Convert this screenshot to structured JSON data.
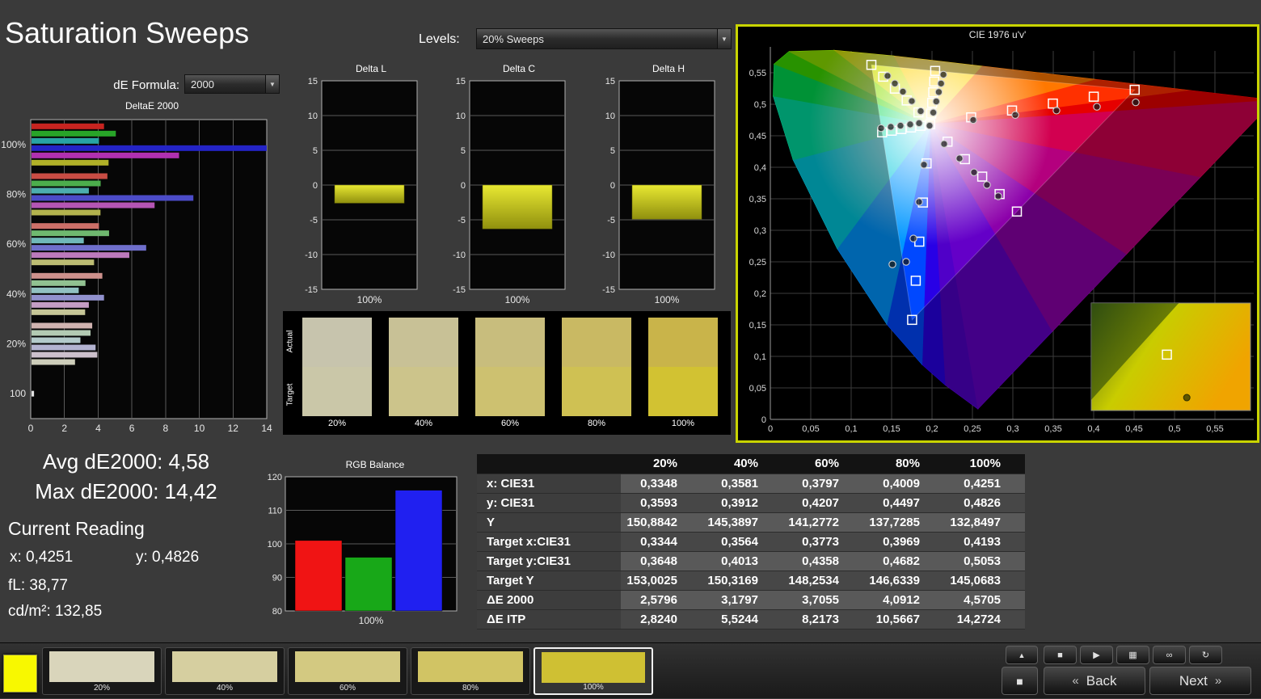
{
  "page": {
    "title": "Saturation Sweeps"
  },
  "controls": {
    "de_formula_label": "dE Formula:",
    "de_formula_value": "2000",
    "levels_label": "Levels:",
    "levels_value": "20% Sweeps"
  },
  "stats": {
    "avg": "Avg dE2000: 4,58",
    "max": "Max dE2000: 14,42",
    "current_reading": "Current Reading",
    "x": "x: 0,4251",
    "y": "y: 0,4826",
    "fl": "fL: 38,77",
    "cdm2": "cd/m²: 132,85"
  },
  "chart_data": [
    {
      "id": "deltae2000",
      "type": "bar",
      "orientation": "horizontal",
      "title": "DeltaE 2000",
      "xlim": [
        0,
        14
      ],
      "xticks": [
        0,
        2,
        4,
        6,
        8,
        10,
        12,
        14
      ],
      "groups": [
        {
          "label": "100%",
          "bars": [
            {
              "name": "red",
              "value": 4.3,
              "color": "#c62420"
            },
            {
              "name": "green",
              "value": 5.0,
              "color": "#28a428"
            },
            {
              "name": "cyan",
              "value": 4.0,
              "color": "#28a4a4"
            },
            {
              "name": "blue",
              "value": 14.42,
              "color": "#2424c6"
            },
            {
              "name": "magenta",
              "value": 8.75,
              "color": "#b030b0"
            },
            {
              "name": "yellow",
              "value": 4.57,
              "color": "#b0b028"
            }
          ]
        },
        {
          "label": "80%",
          "bars": [
            {
              "name": "red",
              "value": 4.5,
              "color": "#c84c44"
            },
            {
              "name": "green",
              "value": 4.1,
              "color": "#4cae4c"
            },
            {
              "name": "cyan",
              "value": 3.4,
              "color": "#4caeae"
            },
            {
              "name": "blue",
              "value": 9.6,
              "color": "#4c4cc8"
            },
            {
              "name": "magenta",
              "value": 7.3,
              "color": "#b455b4"
            },
            {
              "name": "yellow",
              "value": 4.09,
              "color": "#b2b24e"
            }
          ]
        },
        {
          "label": "60%",
          "bars": [
            {
              "name": "red",
              "value": 4.0,
              "color": "#cb6f68"
            },
            {
              "name": "green",
              "value": 4.6,
              "color": "#6fb86f"
            },
            {
              "name": "cyan",
              "value": 3.1,
              "color": "#6fb8b8"
            },
            {
              "name": "blue",
              "value": 6.8,
              "color": "#6f6fcb"
            },
            {
              "name": "magenta",
              "value": 5.8,
              "color": "#bc79bc"
            },
            {
              "name": "yellow",
              "value": 3.71,
              "color": "#bcbc73"
            }
          ]
        },
        {
          "label": "40%",
          "bars": [
            {
              "name": "red",
              "value": 4.2,
              "color": "#cd918c"
            },
            {
              "name": "green",
              "value": 3.2,
              "color": "#91c191"
            },
            {
              "name": "cyan",
              "value": 2.8,
              "color": "#91c1c1"
            },
            {
              "name": "blue",
              "value": 4.3,
              "color": "#9191cd"
            },
            {
              "name": "magenta",
              "value": 3.4,
              "color": "#c49dc4"
            },
            {
              "name": "yellow",
              "value": 3.18,
              "color": "#c5c597"
            }
          ]
        },
        {
          "label": "20%",
          "bars": [
            {
              "name": "red",
              "value": 3.6,
              "color": "#d0b3b0"
            },
            {
              "name": "green",
              "value": 3.5,
              "color": "#b3cab3"
            },
            {
              "name": "cyan",
              "value": 2.9,
              "color": "#b3caca"
            },
            {
              "name": "blue",
              "value": 3.8,
              "color": "#b3b3d0"
            },
            {
              "name": "magenta",
              "value": 3.9,
              "color": "#ccc0cc"
            },
            {
              "name": "yellow",
              "value": 2.58,
              "color": "#cdcdba"
            }
          ]
        },
        {
          "label": "100",
          "bars": [
            {
              "name": "white",
              "value": 0.15,
              "color": "#e2e2e2"
            }
          ]
        }
      ]
    },
    {
      "id": "delta_l",
      "type": "bar",
      "title": "Delta L",
      "ylim": [
        -15,
        15
      ],
      "yticks": [
        15,
        10,
        5,
        0,
        -5,
        -10,
        -15
      ],
      "categories": [
        "100%"
      ],
      "values": [
        -2.6
      ],
      "bar_top_color": "#e8e832",
      "bar_bottom_color": "#90900e"
    },
    {
      "id": "delta_c",
      "type": "bar",
      "title": "Delta C",
      "ylim": [
        -15,
        15
      ],
      "yticks": [
        15,
        10,
        5,
        0,
        -5,
        -10,
        -15
      ],
      "categories": [
        "100%"
      ],
      "values": [
        -6.3
      ],
      "bar_top_color": "#e8e832",
      "bar_bottom_color": "#90900e"
    },
    {
      "id": "delta_h",
      "type": "bar",
      "title": "Delta H",
      "ylim": [
        -15,
        15
      ],
      "yticks": [
        15,
        10,
        5,
        0,
        -5,
        -10,
        -15
      ],
      "categories": [
        "100%"
      ],
      "values": [
        -4.9
      ],
      "bar_top_color": "#e8e832",
      "bar_bottom_color": "#90900e"
    },
    {
      "id": "rgb_balance",
      "type": "bar",
      "title": "RGB Balance",
      "ylim": [
        80,
        120
      ],
      "yticks": [
        120,
        110,
        100,
        90,
        80
      ],
      "categories": [
        "100%"
      ],
      "series": [
        {
          "name": "red",
          "value": 101,
          "color": "#f01414"
        },
        {
          "name": "green",
          "value": 96,
          "color": "#18a818"
        },
        {
          "name": "blue",
          "value": 116,
          "color": "#2020f0"
        }
      ]
    },
    {
      "id": "cie_1976",
      "type": "scatter",
      "title": "CIE 1976 u'v'",
      "xlim": [
        0,
        0.6
      ],
      "ylim": [
        0,
        0.6
      ],
      "grid": true,
      "tick_values": [
        0,
        0.05,
        0.1,
        0.15,
        0.2,
        0.25,
        0.3,
        0.35,
        0.4,
        0.45,
        0.5,
        0.55
      ],
      "tick_labels": [
        "0",
        "0,05",
        "0,1",
        "0,15",
        "0,2",
        "0,25",
        "0,3",
        "0,35",
        "0,4",
        "0,45",
        "0,5",
        "0,55"
      ],
      "white_point": [
        0.1978,
        0.4683
      ],
      "gamut": {
        "red": [
          0.4507,
          0.5229
        ],
        "green": [
          0.125,
          0.5625
        ],
        "blue": [
          0.1754,
          0.1579
        ]
      },
      "targets": {
        "white": [
          [
            0.1978,
            0.4683
          ]
        ],
        "red": [
          [
            0.2484,
            0.4792
          ],
          [
            0.299,
            0.4901
          ],
          [
            0.3495,
            0.5011
          ],
          [
            0.4001,
            0.512
          ],
          [
            0.4507,
            0.5229
          ]
        ],
        "green": [
          [
            0.1832,
            0.4871
          ],
          [
            0.1687,
            0.506
          ],
          [
            0.1541,
            0.5248
          ],
          [
            0.1396,
            0.5437
          ],
          [
            0.125,
            0.5625
          ]
        ],
        "blue": [
          [
            0.1933,
            0.4062
          ],
          [
            0.1888,
            0.3441
          ],
          [
            0.1843,
            0.282
          ],
          [
            0.1799,
            0.22
          ],
          [
            0.1754,
            0.1579
          ]
        ],
        "cyan": [
          [
            0.1859,
            0.4657
          ],
          [
            0.174,
            0.4631
          ],
          [
            0.1621,
            0.4606
          ],
          [
            0.1502,
            0.458
          ],
          [
            0.1383,
            0.4554
          ]
        ],
        "magenta": [
          [
            0.2192,
            0.4406
          ],
          [
            0.2407,
            0.4129
          ],
          [
            0.2621,
            0.3852
          ],
          [
            0.2836,
            0.3575
          ],
          [
            0.305,
            0.3298
          ]
        ],
        "yellow": [
          [
            0.199,
            0.4852
          ],
          [
            0.2002,
            0.5021
          ],
          [
            0.2015,
            0.519
          ],
          [
            0.2027,
            0.536
          ],
          [
            0.2039,
            0.5529
          ]
        ]
      },
      "measured": {
        "white": [
          [
            0.197,
            0.466
          ]
        ],
        "red": [
          [
            0.251,
            0.475
          ],
          [
            0.303,
            0.483
          ],
          [
            0.354,
            0.49
          ],
          [
            0.404,
            0.496
          ],
          [
            0.452,
            0.503
          ]
        ],
        "green": [
          [
            0.186,
            0.489
          ],
          [
            0.175,
            0.505
          ],
          [
            0.164,
            0.52
          ],
          [
            0.154,
            0.533
          ],
          [
            0.145,
            0.545
          ]
        ],
        "blue": [
          [
            0.19,
            0.404
          ],
          [
            0.184,
            0.345
          ],
          [
            0.177,
            0.287
          ],
          [
            0.168,
            0.25
          ],
          [
            0.151,
            0.246
          ]
        ],
        "cyan": [
          [
            0.184,
            0.47
          ],
          [
            0.173,
            0.468
          ],
          [
            0.161,
            0.466
          ],
          [
            0.149,
            0.464
          ],
          [
            0.137,
            0.462
          ]
        ],
        "magenta": [
          [
            0.215,
            0.437
          ],
          [
            0.234,
            0.414
          ],
          [
            0.252,
            0.392
          ],
          [
            0.268,
            0.372
          ],
          [
            0.282,
            0.354
          ]
        ],
        "yellow": [
          [
            0.2016,
            0.4868
          ],
          [
            0.2053,
            0.5045
          ],
          [
            0.2084,
            0.5194
          ],
          [
            0.2112,
            0.5329
          ],
          [
            0.2141,
            0.547
          ]
        ]
      },
      "inset": {
        "square": [
          0.475,
          0.48
        ],
        "dot": [
          0.6,
          0.88
        ]
      }
    }
  ],
  "comparison_strip": {
    "row_labels": [
      "Actual",
      "Target"
    ],
    "columns": [
      {
        "label": "20%",
        "actual": "#c7c4ad",
        "target": "#cac7a8"
      },
      {
        "label": "40%",
        "actual": "#c8c196",
        "target": "#ccc48b"
      },
      {
        "label": "60%",
        "actual": "#c8bd7d",
        "target": "#cdc170"
      },
      {
        "label": "80%",
        "actual": "#c9b963",
        "target": "#cfc153"
      },
      {
        "label": "100%",
        "actual": "#c9b44a",
        "target": "#d2c232"
      }
    ]
  },
  "table": {
    "header": [
      "",
      "20%",
      "40%",
      "60%",
      "80%",
      "100%"
    ],
    "rows": [
      {
        "label": "x: CIE31",
        "values": [
          "0,3348",
          "0,3581",
          "0,3797",
          "0,4009",
          "0,4251"
        ]
      },
      {
        "label": "y: CIE31",
        "values": [
          "0,3593",
          "0,3912",
          "0,4207",
          "0,4497",
          "0,4826"
        ]
      },
      {
        "label": "Y",
        "values": [
          "150,8842",
          "145,3897",
          "141,2772",
          "137,7285",
          "132,8497"
        ]
      },
      {
        "label": "Target x:CIE31",
        "values": [
          "0,3344",
          "0,3564",
          "0,3773",
          "0,3969",
          "0,4193"
        ]
      },
      {
        "label": "Target y:CIE31",
        "values": [
          "0,3648",
          "0,4013",
          "0,4358",
          "0,4682",
          "0,5053"
        ]
      },
      {
        "label": "Target Y",
        "values": [
          "153,0025",
          "150,3169",
          "148,2534",
          "146,6339",
          "145,0683"
        ]
      },
      {
        "label": "ΔE 2000",
        "values": [
          "2,5796",
          "3,1797",
          "3,7055",
          "4,0912",
          "4,5705"
        ]
      },
      {
        "label": "ΔE ITP",
        "values": [
          "2,8240",
          "5,5244",
          "8,2173",
          "10,5667",
          "14,2724"
        ]
      }
    ]
  },
  "toolbar": {
    "active_swatch_color": "#f8f800",
    "patches": [
      {
        "label": "20%",
        "color": "#d9d5bb",
        "selected": false
      },
      {
        "label": "40%",
        "color": "#d6cfa0",
        "selected": false
      },
      {
        "label": "60%",
        "color": "#d3c981",
        "selected": false
      },
      {
        "label": "80%",
        "color": "#d1c464",
        "selected": false
      },
      {
        "label": "100%",
        "color": "#cfc033",
        "selected": true
      }
    ],
    "transport": {
      "scroll_up_glyph": "▲",
      "stop_large_glyph": "■",
      "buttons": [
        {
          "name": "stop",
          "glyph": "■"
        },
        {
          "name": "play",
          "glyph": "▶"
        },
        {
          "name": "pattern",
          "glyph": "▦"
        },
        {
          "name": "continuous",
          "glyph": "∞"
        },
        {
          "name": "repeat",
          "glyph": "↻"
        }
      ],
      "back_chevron": "«",
      "back_label": "Back",
      "next_label": "Next",
      "next_chevron": "»"
    }
  }
}
